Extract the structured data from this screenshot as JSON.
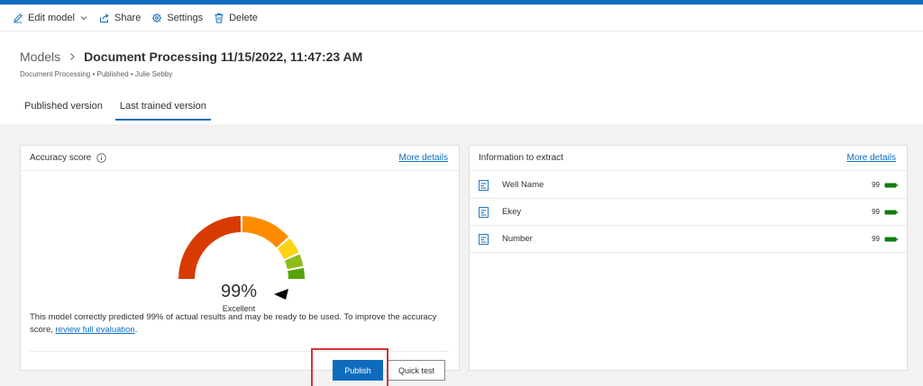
{
  "toolbar": {
    "edit_label": "Edit model",
    "share_label": "Share",
    "settings_label": "Settings",
    "delete_label": "Delete"
  },
  "header": {
    "breadcrumb_root": "Models",
    "title": "Document Processing 11/15/2022, 11:47:23 AM",
    "subline": "Document Processing • Published • Julie Sebby"
  },
  "tabs": [
    {
      "label": "Published version",
      "active": false
    },
    {
      "label": "Last trained version",
      "active": true
    }
  ],
  "accuracy_card": {
    "title": "Accuracy score",
    "more_details": "More details",
    "score": "99%",
    "rating": "Excellent",
    "score_value": 99,
    "description": "This model correctly predicted 99% of actual results and may be ready to be used. To improve the accuracy score, ",
    "link_text": "review full evaluation",
    "link_suffix": ".",
    "publish_label": "Publish",
    "quick_test_label": "Quick test"
  },
  "info_card": {
    "title": "Information to extract",
    "more_details": "More details",
    "fields": [
      {
        "name": "Well Name",
        "score": "99"
      },
      {
        "name": "Ekey",
        "score": "99"
      },
      {
        "name": "Number",
        "score": "99"
      }
    ]
  },
  "colors": {
    "accent": "#0f6cbd",
    "highlight": "#d13438",
    "gauge_red": "#d83b01",
    "gauge_orange": "#ff8c00",
    "gauge_yellow": "#fcd116",
    "gauge_lime": "#8cbd18",
    "gauge_green": "#57a300",
    "confidence_green": "#107c10"
  }
}
